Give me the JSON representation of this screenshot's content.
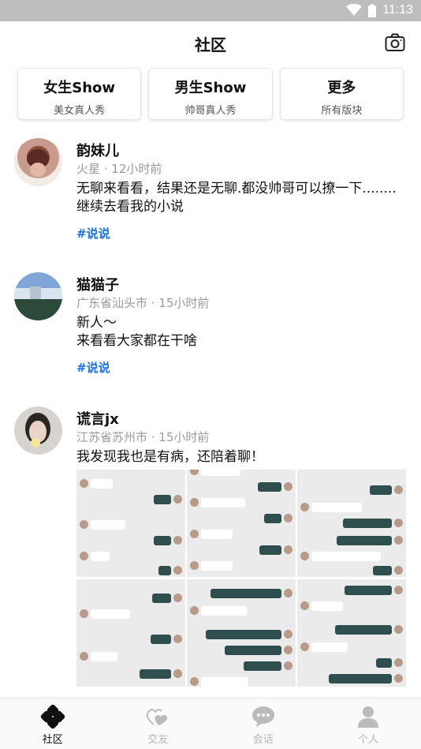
{
  "status_bar": {
    "time": "11:13",
    "wifi_icon": "wifi-icon",
    "battery_icon": "battery-icon"
  },
  "header": {
    "title": "社区",
    "camera_icon": "camera-icon"
  },
  "categories": [
    {
      "title": "女生Show",
      "subtitle": "美女真人秀"
    },
    {
      "title": "男生Show",
      "subtitle": "帅哥真人秀"
    },
    {
      "title": "更多",
      "subtitle": "所有版块"
    }
  ],
  "posts": [
    {
      "name": "韵妹儿",
      "meta": "火星 · 12小时前",
      "text": "无聊来看看，结果还是无聊.都没帅哥可以撩一下........继续去看我的小说",
      "tag": "#说说"
    },
    {
      "name": "猫猫子",
      "meta": "广东省汕头市 · 15小时前",
      "text": "新人～\n来看看大家都在干啥",
      "tag": "#说说"
    },
    {
      "name": "谎言jx",
      "meta": "江苏省苏州市 · 15小时前",
      "text": "我发现我也是有病，还陪着聊！",
      "images_count": 6
    }
  ],
  "tabbar": [
    {
      "label": "社区",
      "icon": "community-icon",
      "active": true
    },
    {
      "label": "交友",
      "icon": "friends-heart-icon",
      "active": false
    },
    {
      "label": "会话",
      "icon": "chat-bubble-icon",
      "active": false
    },
    {
      "label": "个人",
      "icon": "person-icon",
      "active": false
    }
  ],
  "colors": {
    "accent_tag": "#1a73e8",
    "tab_active": "#111111",
    "tab_inactive": "#b5b5b5",
    "status_bar": "#bdbdbd"
  }
}
